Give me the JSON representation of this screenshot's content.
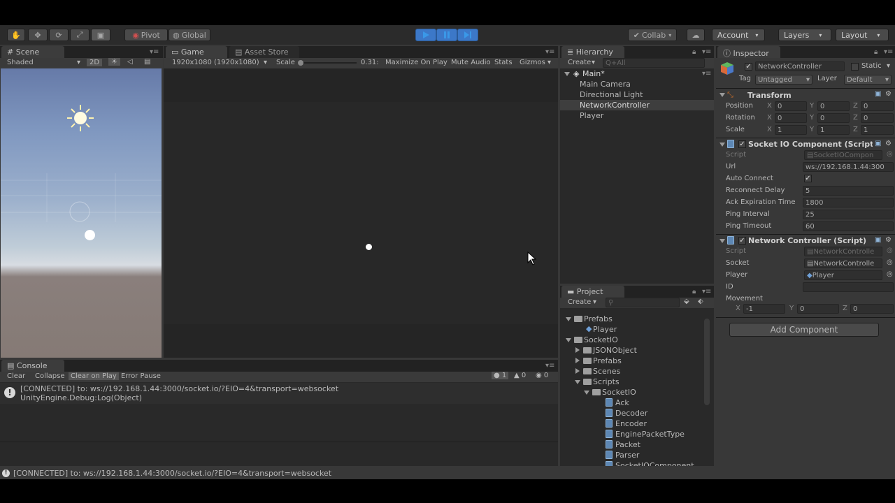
{
  "toolbar": {
    "pivot": "Pivot",
    "global": "Global",
    "collab": "Collab",
    "account": "Account",
    "layers": "Layers",
    "layout": "Layout"
  },
  "scene": {
    "tab": "Scene",
    "shading": "Shaded",
    "mode_2d": "2D"
  },
  "game": {
    "tab": "Game",
    "tab2": "Asset Store",
    "resolution": "1920x1080 (1920x1080)",
    "scale_label": "Scale",
    "scale_value": "0.31:",
    "maximize": "Maximize On Play",
    "mute": "Mute Audio",
    "stats": "Stats",
    "gizmos": "Gizmos"
  },
  "hierarchy": {
    "tab": "Hierarchy",
    "create": "Create",
    "search_placeholder": "Q+All",
    "scene_name": "Main*",
    "items": [
      "Main Camera",
      "Directional Light",
      "NetworkController",
      "Player"
    ]
  },
  "project": {
    "tab": "Project",
    "create": "Create",
    "tree": [
      {
        "label": "Prefabs",
        "depth": 0,
        "type": "folder",
        "open": true
      },
      {
        "label": "Player",
        "depth": 1,
        "type": "prefab"
      },
      {
        "label": "SocketIO",
        "depth": 0,
        "type": "folder",
        "open": true
      },
      {
        "label": "JSONObject",
        "depth": 1,
        "type": "folder",
        "open": false
      },
      {
        "label": "Prefabs",
        "depth": 1,
        "type": "folder",
        "open": false
      },
      {
        "label": "Scenes",
        "depth": 1,
        "type": "folder",
        "open": false
      },
      {
        "label": "Scripts",
        "depth": 1,
        "type": "folder",
        "open": true
      },
      {
        "label": "SocketIO",
        "depth": 2,
        "type": "folder",
        "open": true
      },
      {
        "label": "Ack",
        "depth": 3,
        "type": "script"
      },
      {
        "label": "Decoder",
        "depth": 3,
        "type": "script"
      },
      {
        "label": "Encoder",
        "depth": 3,
        "type": "script"
      },
      {
        "label": "EnginePacketType",
        "depth": 3,
        "type": "script"
      },
      {
        "label": "Packet",
        "depth": 3,
        "type": "script"
      },
      {
        "label": "Parser",
        "depth": 3,
        "type": "script"
      },
      {
        "label": "SocketIOComponent",
        "depth": 3,
        "type": "script"
      }
    ]
  },
  "inspector": {
    "tab": "Inspector",
    "object_name": "NetworkController",
    "static_label": "Static",
    "tag_label": "Tag",
    "tag_value": "Untagged",
    "layer_label": "Layer",
    "layer_value": "Default",
    "transform": {
      "title": "Transform",
      "position_label": "Position",
      "rotation_label": "Rotation",
      "scale_label": "Scale",
      "position": [
        "0",
        "0",
        "0"
      ],
      "rotation": [
        "0",
        "0",
        "0"
      ],
      "scale": [
        "1",
        "1",
        "1"
      ],
      "axis": [
        "X",
        "Y",
        "Z"
      ]
    },
    "socketio": {
      "title": "Socket IO Component (Script",
      "script_label": "Script",
      "script_value": "SocketIOCompon",
      "url_label": "Url",
      "url_value": "ws://192.168.1.44:300",
      "auto_connect_label": "Auto Connect",
      "reconnect_label": "Reconnect Delay",
      "reconnect_value": "5",
      "ack_label": "Ack Expiration Time",
      "ack_value": "1800",
      "ping_interval_label": "Ping Interval",
      "ping_interval_value": "25",
      "ping_timeout_label": "Ping Timeout",
      "ping_timeout_value": "60"
    },
    "netctrl": {
      "title": "Network Controller (Script)",
      "script_label": "Script",
      "script_value": "NetworkControlle",
      "socket_label": "Socket",
      "socket_value": "NetworkControlle",
      "player_label": "Player",
      "player_value": "Player",
      "id_label": "ID",
      "movement_label": "Movement",
      "movement": [
        "-1",
        "0",
        "0"
      ]
    },
    "add_component": "Add Component"
  },
  "console": {
    "tab": "Console",
    "clear": "Clear",
    "collapse": "Collapse",
    "clear_on_play": "Clear on Play",
    "error_pause": "Error Pause",
    "count_info": "1",
    "count_warn": "0",
    "count_err": "0",
    "log_line1": "[CONNECTED] to: ws://192.168.1.44:3000/socket.io/?EIO=4&transport=websocket",
    "log_line2": "UnityEngine.Debug:Log(Object)"
  },
  "status_bar": "[CONNECTED] to: ws://192.168.1.44:3000/socket.io/?EIO=4&transport=websocket",
  "colors": {
    "play_active": "#3c78c8",
    "selection": "#3e3e3e"
  }
}
